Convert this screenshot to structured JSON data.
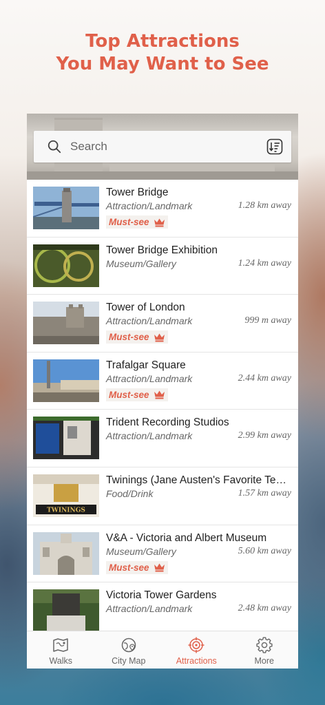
{
  "headline": {
    "line1": "Top Attractions",
    "line2": "You May Want to See"
  },
  "search": {
    "placeholder": "Search"
  },
  "colors": {
    "accent": "#e0604a",
    "text": "#222222",
    "muted": "#666666"
  },
  "attractions": [
    {
      "name": "Tower Bridge",
      "category": "Attraction/Landmark",
      "distance": "1.28 km away",
      "must_see": true,
      "badge": "Must-see"
    },
    {
      "name": "Tower Bridge Exhibition",
      "category": "Museum/Gallery",
      "distance": "1.24 km away",
      "must_see": false
    },
    {
      "name": "Tower of London",
      "category": "Attraction/Landmark",
      "distance": "999 m away",
      "must_see": true,
      "badge": "Must-see"
    },
    {
      "name": "Trafalgar Square",
      "category": "Attraction/Landmark",
      "distance": "2.44 km away",
      "must_see": true,
      "badge": "Must-see"
    },
    {
      "name": "Trident Recording Studios",
      "category": "Attraction/Landmark",
      "distance": "2.99 km away",
      "must_see": false
    },
    {
      "name": "Twinings (Jane Austen's Favorite Tea...",
      "category": "Food/Drink",
      "distance": "1.57 km away",
      "must_see": false,
      "thumb_sign": "TWININGS"
    },
    {
      "name": "V&A - Victoria and Albert Museum",
      "category": "Museum/Gallery",
      "distance": "5.60 km away",
      "must_see": true,
      "badge": "Must-see"
    },
    {
      "name": "Victoria Tower Gardens",
      "category": "Attraction/Landmark",
      "distance": "2.48 km away",
      "must_see": false
    }
  ],
  "tabs": [
    {
      "label": "Walks",
      "icon": "map-icon",
      "active": false
    },
    {
      "label": "City Map",
      "icon": "globe-pin-icon",
      "active": false
    },
    {
      "label": "Attractions",
      "icon": "target-icon",
      "active": true
    },
    {
      "label": "More",
      "icon": "gear-icon",
      "active": false
    }
  ]
}
